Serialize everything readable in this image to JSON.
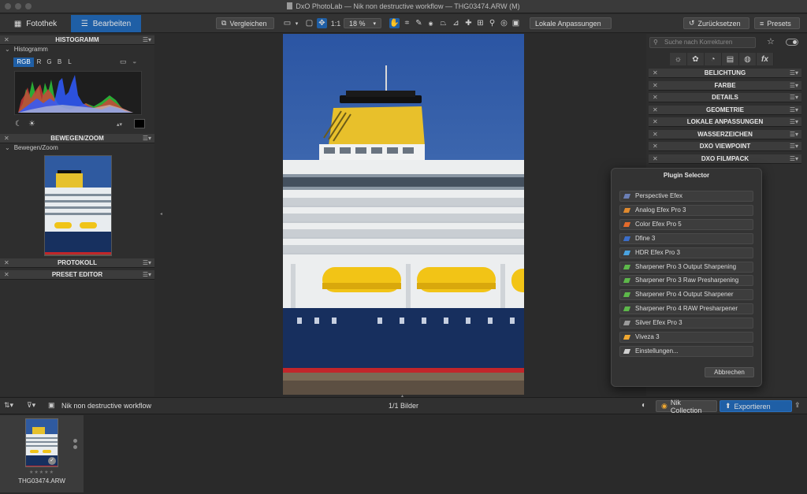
{
  "window": {
    "title": "DxO PhotoLab — Nik non destructive workflow — THG03474.ARW (M)"
  },
  "toolbar": {
    "tab_library": "Fotothek",
    "tab_edit": "Bearbeiten",
    "compare_label": "Vergleichen",
    "one_to_one": "1:1",
    "zoom_value": "18 %",
    "local_adjust_label": "Lokale Anpassungen",
    "reset_label": "Zurücksetzen",
    "presets_label": "Presets"
  },
  "left_panel": {
    "histogram_header": "HISTOGRAMM",
    "histogram_sub": "Histogramm",
    "channels": [
      "RGB",
      "R",
      "G",
      "B",
      "L"
    ],
    "move_zoom_header": "BEWEGEN/ZOOM",
    "move_zoom_sub": "Bewegen/Zoom",
    "protocol_header": "PROTOKOLL",
    "preset_editor_header": "PRESET EDITOR"
  },
  "right_panel": {
    "search_placeholder": "Suche nach Korrekturen",
    "sections": [
      "BELICHTUNG",
      "FARBE",
      "DETAILS",
      "GEOMETRIE",
      "LOKALE ANPASSUNGEN",
      "WASSERZEICHEN",
      "DXO VIEWPOINT",
      "DXO FILMPACK"
    ]
  },
  "plugin_selector": {
    "title": "Plugin Selector",
    "items": [
      {
        "label": "Perspective Efex",
        "color": "#6b7fb5"
      },
      {
        "label": "Analog Efex Pro 3",
        "color": "#e08a2e"
      },
      {
        "label": "Color Efex Pro 5",
        "color": "#e36a2b"
      },
      {
        "label": "Dfine 3",
        "color": "#3b6ec9"
      },
      {
        "label": "HDR Efex Pro 3",
        "color": "#4aa3e0"
      },
      {
        "label": "Sharpener Pro 3 Output Sharpening",
        "color": "#5db84a"
      },
      {
        "label": "Sharpener Pro 3 Raw Presharpening",
        "color": "#5db84a"
      },
      {
        "label": "Sharpener Pro 4 Output Sharpener",
        "color": "#5db84a"
      },
      {
        "label": "Sharpener Pro 4 RAW Presharpener",
        "color": "#5db84a"
      },
      {
        "label": "Silver Efex Pro 3",
        "color": "#9a9a9a"
      },
      {
        "label": "Viveza 3",
        "color": "#f0a830"
      },
      {
        "label": "Einstellungen...",
        "color": "#cfcfcf"
      }
    ],
    "cancel_label": "Abbrechen"
  },
  "bottom_bar": {
    "project_label": "Nik non destructive workflow",
    "count_label": "1/1 Bilder",
    "nik_label": "Nik Collection",
    "export_label": "Exportieren"
  },
  "filmstrip": {
    "filename": "THG03474.ARW",
    "rating_stars": "★★★★★"
  }
}
